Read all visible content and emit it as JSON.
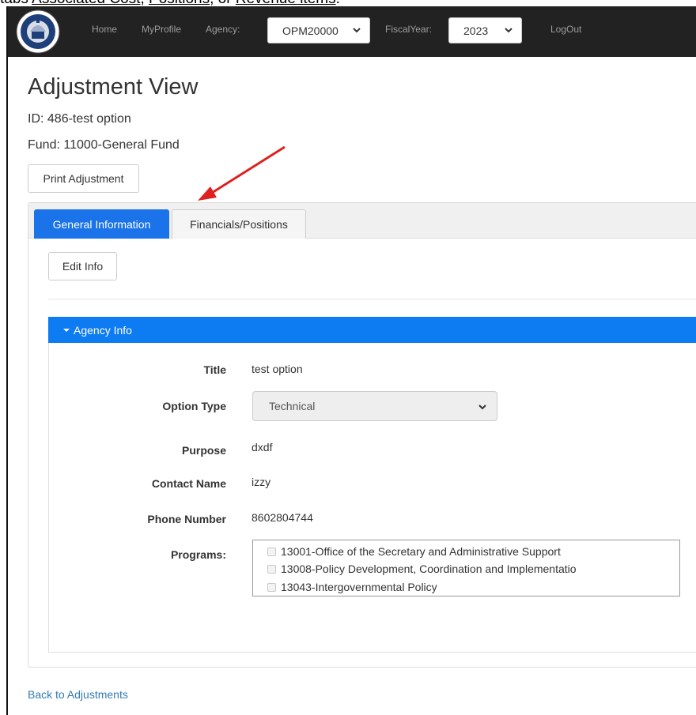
{
  "doc_strip": {
    "prefix": "tabs ",
    "link1": "Associated Cost",
    "sep1": ", ",
    "link2": "Positions",
    "sep2": ", or ",
    "link3": "Revenue items",
    "suffix": "."
  },
  "nav": {
    "home": "Home",
    "profile": "MyProfile",
    "agency_label": "Agency:",
    "agency_value": "OPM20000",
    "fiscal_label": "FiscalYear:",
    "fiscal_value": "2023",
    "logout": "LogOut",
    "logo_icon": "agency-seal-icon"
  },
  "page": {
    "title": "Adjustment View",
    "id_line": "ID: 486-test option",
    "fund_line": "Fund: 11000-General Fund",
    "print_button": "Print Adjustment"
  },
  "tabs": [
    {
      "label": "General Information",
      "active": true
    },
    {
      "label": "Financials/Positions",
      "active": false
    }
  ],
  "edit_button": "Edit Info",
  "agency_info": {
    "header": "Agency Info",
    "fields": {
      "title_label": "Title",
      "title_value": "test option",
      "option_type_label": "Option Type",
      "option_type_value": "Technical",
      "purpose_label": "Purpose",
      "purpose_value": "dxdf",
      "contact_label": "Contact Name",
      "contact_value": "izzy",
      "phone_label": "Phone Number",
      "phone_value": "8602804744",
      "programs_label": "Programs:"
    },
    "programs": [
      "13001-Office of the Secretary and Administrative Support",
      "13008-Policy Development, Coordination and Implementatio",
      "13043-Intergovernmental Policy"
    ]
  },
  "back_link": "Back to Adjustments",
  "colors": {
    "navbar": "#222222",
    "active_tab": "#1a73e8",
    "panel_header": "#0d7bf2",
    "arrow": "#e02020",
    "link": "#337ab7"
  }
}
